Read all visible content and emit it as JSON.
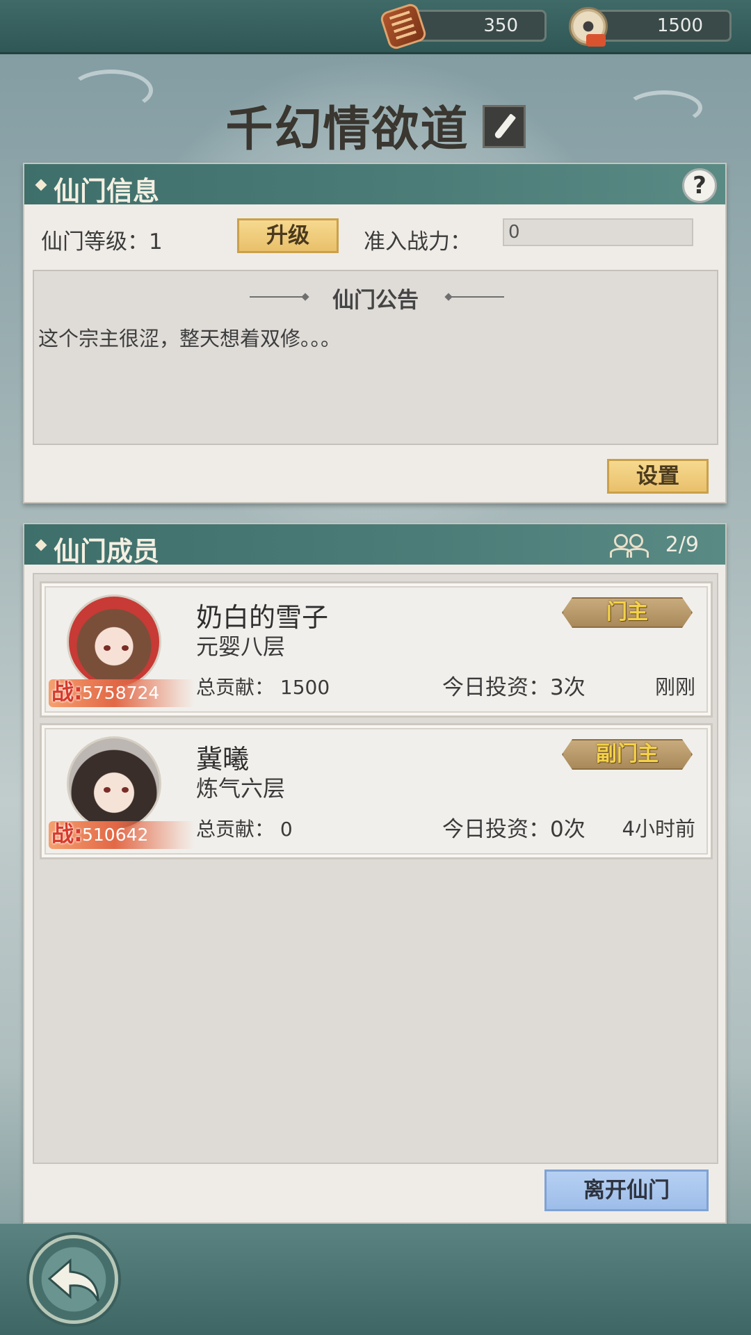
{
  "resources": [
    {
      "icon": "abacus-icon",
      "value": "350"
    },
    {
      "icon": "jade-coin-icon",
      "value": "1500"
    }
  ],
  "sect": {
    "name": "千幻情欲道"
  },
  "info_panel": {
    "title": "仙门信息",
    "level_label": "仙门等级：1",
    "upgrade_label": "升级",
    "power_label": "准入战力：",
    "power_value": "0",
    "notice_title": "仙门公告",
    "notice_text": "这个宗主很涩，整天想着双修。。。",
    "settings_label": "设置"
  },
  "members_panel": {
    "title": "仙门成员",
    "count": "2/9",
    "members": [
      {
        "name": "奶白的雪子",
        "realm": "元婴八层",
        "power_prefix": "战:",
        "power": "5758724",
        "contribution": "总贡献：  1500",
        "invest": "今日投资：3次",
        "last_seen": "刚刚",
        "rank": "门主"
      },
      {
        "name": "冀曦",
        "realm": "炼气六层",
        "power_prefix": "战:",
        "power": "510642",
        "contribution": "总贡献：  0",
        "invest": "今日投资：0次",
        "last_seen": "4小时前",
        "rank": "副门主"
      }
    ],
    "leave_label": "离开仙门"
  },
  "colors": {
    "header_teal": "#3e6f6b",
    "gold_button": "#e9c06b",
    "blue_button": "#9dbde9",
    "power_tag": "#e26846"
  }
}
